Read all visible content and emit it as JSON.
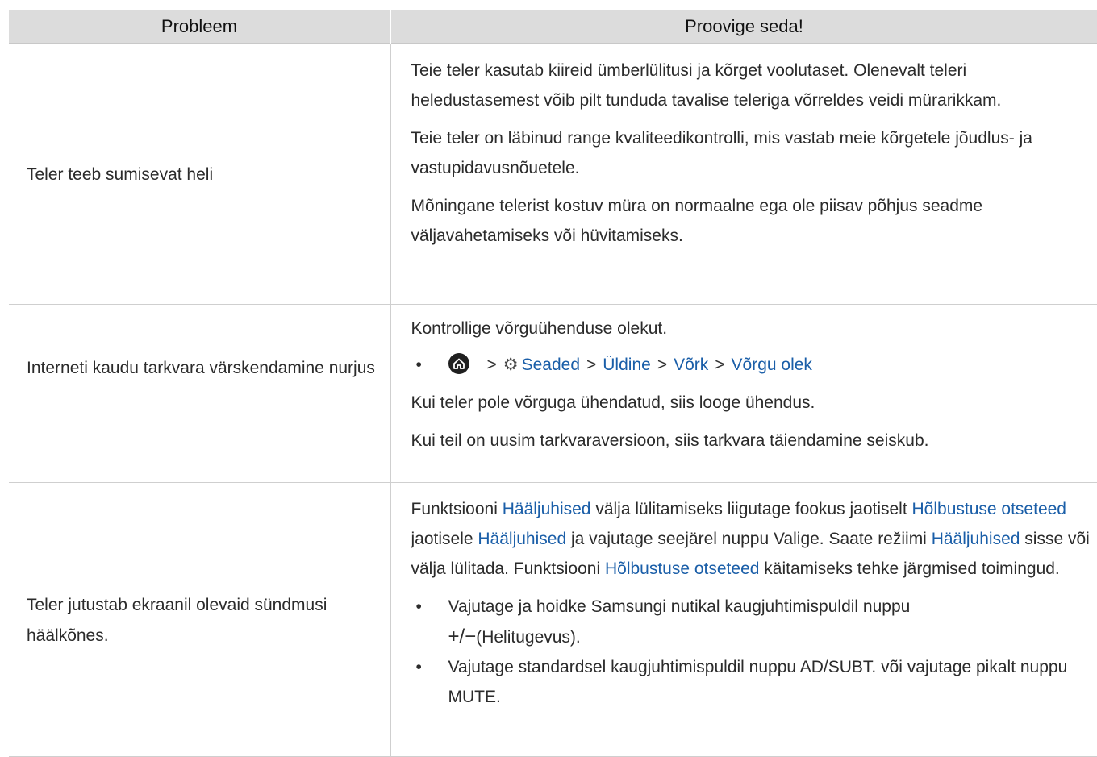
{
  "table": {
    "header_problem": "Probleem",
    "header_solution": "Proovige seda!"
  },
  "rows": [
    {
      "problem": "Teler teeb sumisevat heli",
      "para1": "Teie teler kasutab kiireid ümberlülitusi ja kõrget voolutaset. Olenevalt teleri heledustasemest võib pilt tunduda tavalise teleriga võrreldes veidi mürarikkam.",
      "para2": "Teie teler on läbinud range kvaliteedikontrolli, mis vastab meie kõrgetele jõudlus- ja vastupidavusnõuetele.",
      "para3": "Mõningane telerist kostuv müra on normaalne ega ole piisav põhjus seadme väljavahetamiseks või hüvitamiseks."
    },
    {
      "problem": "Interneti kaudu tarkvara värskendamine nurjus",
      "para1": "Kontrollige võrguühenduse olekut.",
      "path": {
        "icon": "home-icon",
        "settings_icon": "gear-icon",
        "settings": "Seaded",
        "general": "Üldine",
        "network": "Võrk",
        "network_status": "Võrgu olek",
        "separator": ">"
      },
      "para2": "Kui teler pole võrguga ühendatud, siis looge ühendus.",
      "para3": "Kui teil on uusim tarkvaraversioon, siis tarkvara täiendamine seiskub."
    },
    {
      "problem": "Teler jutustab ekraanil olevaid sündmusi häälkõnes.",
      "s1": "Funktsiooni ",
      "l1": "Hääljuhised",
      "s2": " välja lülitamiseks liigutage fookus jaotiselt ",
      "l2": "Hõlbustuse otseteed",
      "s3": " jaotisele ",
      "l3": "Hääljuhised",
      "s4": " ja vajutage seejärel nuppu Valige. Saate režiimi ",
      "l4": "Hääljuhised",
      "s5": " sisse või välja lülitada. Funktsiooni ",
      "l5": "Hõlbustuse otseteed",
      "s6": " käitamiseks tehke järgmised toimingud.",
      "b1_text": "Vajutage ja hoidke Samsungi nutikal kaugjuhtimispuldil nuppu",
      "b1_symbol": "+/−",
      "b1_suffix": "(Helitugevus).",
      "b2": "Vajutage standardsel kaugjuhtimispuldil nuppu AD/SUBT. või vajutage pikalt nuppu MUTE."
    }
  ],
  "colors": {
    "link": "#1a5ea8",
    "header_bg": "#dcdcdc"
  }
}
